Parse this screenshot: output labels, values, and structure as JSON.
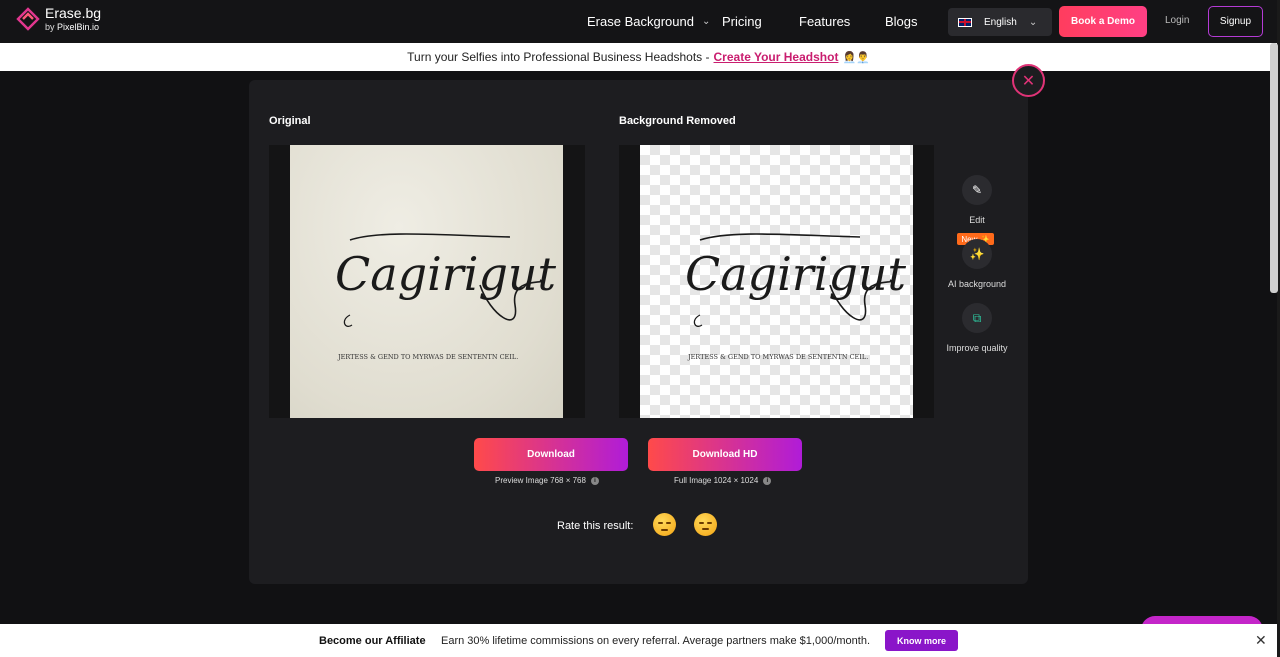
{
  "nav": {
    "logo_title": "Erase.bg",
    "logo_by": "by",
    "logo_brand": "PixelBin.io",
    "links": [
      "Erase Background",
      "Pricing",
      "Features",
      "Blogs"
    ],
    "language": "English",
    "book_demo": "Book a Demo",
    "login": "Login",
    "signup": "Signup"
  },
  "promo": {
    "text": "Turn your Selfies into Professional Business Headshots -",
    "link": "Create Your Headshot",
    "emoji": "👩‍💼👨‍💼"
  },
  "panel": {
    "original_label": "Original",
    "removed_label": "Background Removed",
    "image_main_text": "Cagirigut",
    "image_sub_text": "JERTESS & GEND TO MYRWAS DE SENTENTN CEIL.",
    "tools": {
      "edit": "Edit",
      "new_badge": "New ✨",
      "ai_background": "AI background",
      "improve_quality": "Improve quality"
    },
    "download": {
      "label": "Download",
      "info": "Preview Image 768 × 768"
    },
    "download_hd": {
      "label": "Download HD",
      "info": "Full Image 1024 × 1024"
    },
    "rate_label": "Rate this result:"
  },
  "affiliate": {
    "title": "Become our Affiliate",
    "text": "Earn 30% lifetime commissions on every referral. Average partners make $1,000/month.",
    "button": "Know more"
  },
  "colors": {
    "accent_pink": "#e03377",
    "brand_gradient_start": "#ff4a4a",
    "brand_gradient_end": "#b01cd8",
    "affiliate_button": "#8a15c9"
  }
}
